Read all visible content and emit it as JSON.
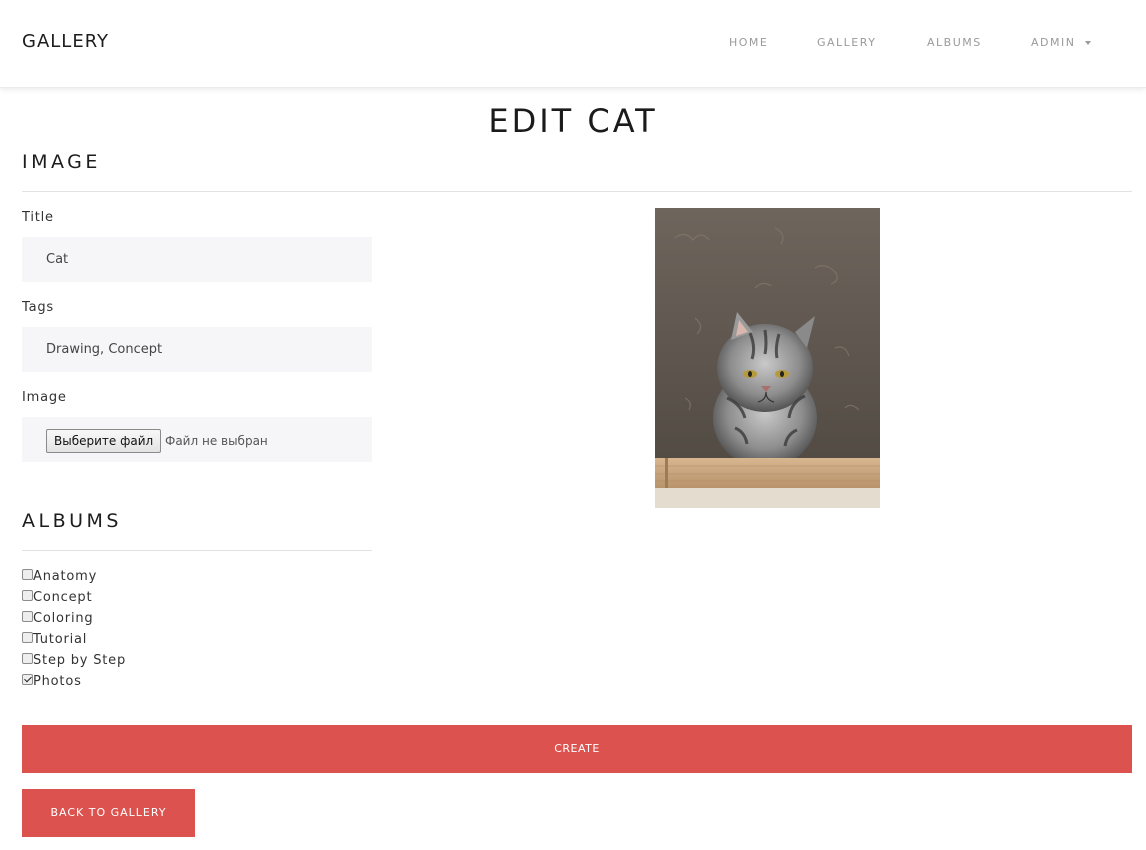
{
  "navbar": {
    "brand": "GALLERY",
    "items": [
      {
        "label": "HOME"
      },
      {
        "label": "GALLERY"
      },
      {
        "label": "ALBUMS"
      },
      {
        "label": "ADMIN"
      }
    ]
  },
  "page": {
    "title": "EDIT CAT"
  },
  "image_section": {
    "heading": "IMAGE",
    "title_label": "Title",
    "title_value": "Cat",
    "tags_label": "Tags",
    "tags_value": "Drawing, Concept",
    "image_label": "Image",
    "file_button": "Выберите файл",
    "file_status": "Файл не выбран"
  },
  "albums_section": {
    "heading": "ALBUMS",
    "items": [
      {
        "label": "Anatomy",
        "checked": false
      },
      {
        "label": "Concept",
        "checked": false
      },
      {
        "label": "Coloring",
        "checked": false
      },
      {
        "label": "Tutorial",
        "checked": false
      },
      {
        "label": "Step by Step",
        "checked": false
      },
      {
        "label": "Photos",
        "checked": true
      }
    ]
  },
  "actions": {
    "create_label": "CREATE",
    "back_label": "BACK TO GALLERY"
  },
  "colors": {
    "accent": "#db524e",
    "field_bg": "#f6f6f8"
  }
}
